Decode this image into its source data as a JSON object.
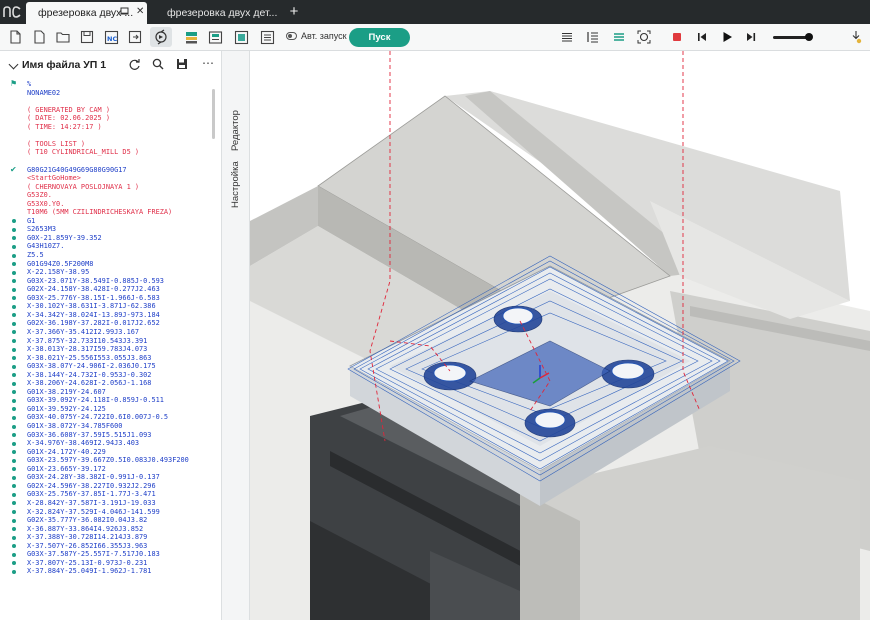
{
  "titlebar": {
    "tabs": [
      {
        "label": "фрезеровка двух ...",
        "active": true
      },
      {
        "label": "фрезеровка двух дет...",
        "active": false
      }
    ]
  },
  "toolbar": {
    "auto_start_label": "Авт. запуск",
    "run_label": "Пуск",
    "colors": {
      "accent": "#1b9e86",
      "stop": "#e03a3e"
    }
  },
  "left_panel": {
    "title": "Имя файла УП 1",
    "code_lines": [
      {
        "text": "%",
        "status": "flag"
      },
      {
        "text": "NONAME02",
        "status": ""
      },
      {
        "text": "",
        "status": ""
      },
      {
        "text": "( GENERATED BY CAM )",
        "status": "",
        "comment": true
      },
      {
        "text": "( DATE: 02.06.2025 )",
        "status": "",
        "comment": true
      },
      {
        "text": "( TIME: 14:27:17 )",
        "status": "",
        "comment": true
      },
      {
        "text": "",
        "status": ""
      },
      {
        "text": "( TOOLS LIST )",
        "status": "",
        "comment": true
      },
      {
        "text": "( T10 CYLINDRICAL_MILL D5 )",
        "status": "",
        "comment": true
      },
      {
        "text": "",
        "status": ""
      },
      {
        "text": "G80G21G40G49G69G80G90G17",
        "status": "check"
      },
      {
        "text": "<StartGoHome>",
        "status": "",
        "comment": true
      },
      {
        "text": "( CHERNOVAYA POSLOJNAYA 1 )",
        "status": "",
        "comment": true
      },
      {
        "text": "G53Z0.",
        "status": "",
        "comment": true
      },
      {
        "text": "G53X0.Y0.",
        "status": "",
        "comment": true
      },
      {
        "text": "T10M6 (5MM CZILINDRICHESKAYA FREZA)",
        "status": "",
        "comment": true
      },
      {
        "text": "G1",
        "status": "dot"
      },
      {
        "text": "S2653M3",
        "status": "dot"
      },
      {
        "text": "G0X-21.859Y-39.352",
        "status": "dot"
      },
      {
        "text": "G43H10Z7.",
        "status": "dot"
      },
      {
        "text": "Z5.5",
        "status": "dot"
      },
      {
        "text": "G01G94Z0.5F200M8",
        "status": "dot"
      },
      {
        "text": "X-22.158Y-38.95",
        "status": "dot"
      },
      {
        "text": "G03X-23.071Y-38.549I-0.885J-0.593",
        "status": "dot"
      },
      {
        "text": "G02X-24.158Y-38.428I-0.277J2.463",
        "status": "dot"
      },
      {
        "text": "G03X-25.776Y-38.15I-1.966J-6.583",
        "status": "dot"
      },
      {
        "text": "X-30.102Y-38.631I-3.871J-62.386",
        "status": "dot"
      },
      {
        "text": "X-34.342Y-38.024I-13.89J-973.184",
        "status": "dot"
      },
      {
        "text": "G02X-36.198Y-37.282I-0.017J2.652",
        "status": "dot"
      },
      {
        "text": "X-37.366Y-35.412I2.99J3.167",
        "status": "dot"
      },
      {
        "text": "X-37.875Y-32.733I10.543J3.391",
        "status": "dot"
      },
      {
        "text": "X-38.013Y-28.317I59.783J4.073",
        "status": "dot"
      },
      {
        "text": "X-38.021Y-25.556I553.055J3.863",
        "status": "dot"
      },
      {
        "text": "G03X-38.07Y-24.906I-2.036J0.175",
        "status": "dot"
      },
      {
        "text": "X-38.144Y-24.732I-0.953J-0.302",
        "status": "dot"
      },
      {
        "text": "X-38.206Y-24.628I-2.056J-1.168",
        "status": "dot"
      },
      {
        "text": "G01X-38.219Y-24.607",
        "status": "dot"
      },
      {
        "text": "G03X-39.092Y-24.118I-0.859J-0.511",
        "status": "dot"
      },
      {
        "text": "G01X-39.592Y-24.125",
        "status": "dot"
      },
      {
        "text": "G03X-40.075Y-24.722I0.6I0.007J-0.5",
        "status": "dot"
      },
      {
        "text": "G01X-38.072Y-34.785F600",
        "status": "dot"
      },
      {
        "text": "G03X-36.608Y-37.59I5.515J1.093",
        "status": "dot"
      },
      {
        "text": "X-34.976Y-38.469I2.94J3.403",
        "status": "dot"
      },
      {
        "text": "G01X-24.172Y-40.229",
        "status": "dot"
      },
      {
        "text": "G03X-23.597Y-39.667Z0.5I0.083J0.493F200",
        "status": "dot"
      },
      {
        "text": "G01X-23.665Y-39.172",
        "status": "dot"
      },
      {
        "text": "G03X-24.28Y-38.382I-0.991J-0.137",
        "status": "dot"
      },
      {
        "text": "G02X-24.596Y-38.227I0.932J2.296",
        "status": "dot"
      },
      {
        "text": "G03X-25.756Y-37.85I-1.77J-3.471",
        "status": "dot"
      },
      {
        "text": "X-28.842Y-37.587I-3.191J-19.033",
        "status": "dot"
      },
      {
        "text": "X-32.824Y-37.529I-4.046J-141.599",
        "status": "dot"
      },
      {
        "text": "G02X-35.777Y-36.082I0.04J3.82",
        "status": "dot"
      },
      {
        "text": "X-36.887Y-33.864I4.926J3.852",
        "status": "dot"
      },
      {
        "text": "X-37.388Y-30.728I14.214J3.879",
        "status": "dot"
      },
      {
        "text": "X-37.507Y-26.852I66.355J3.963",
        "status": "dot"
      },
      {
        "text": "G03X-37.587Y-25.557I-7.517J0.183",
        "status": "dot"
      },
      {
        "text": "X-37.807Y-25.13I-0.973J-0.231",
        "status": "dot"
      },
      {
        "text": "X-37.884Y-25.049I-1.962J-1.781",
        "status": "dot"
      }
    ]
  },
  "side_tabs": {
    "editor_label": "Редактор",
    "settings_label": "Настройка"
  }
}
